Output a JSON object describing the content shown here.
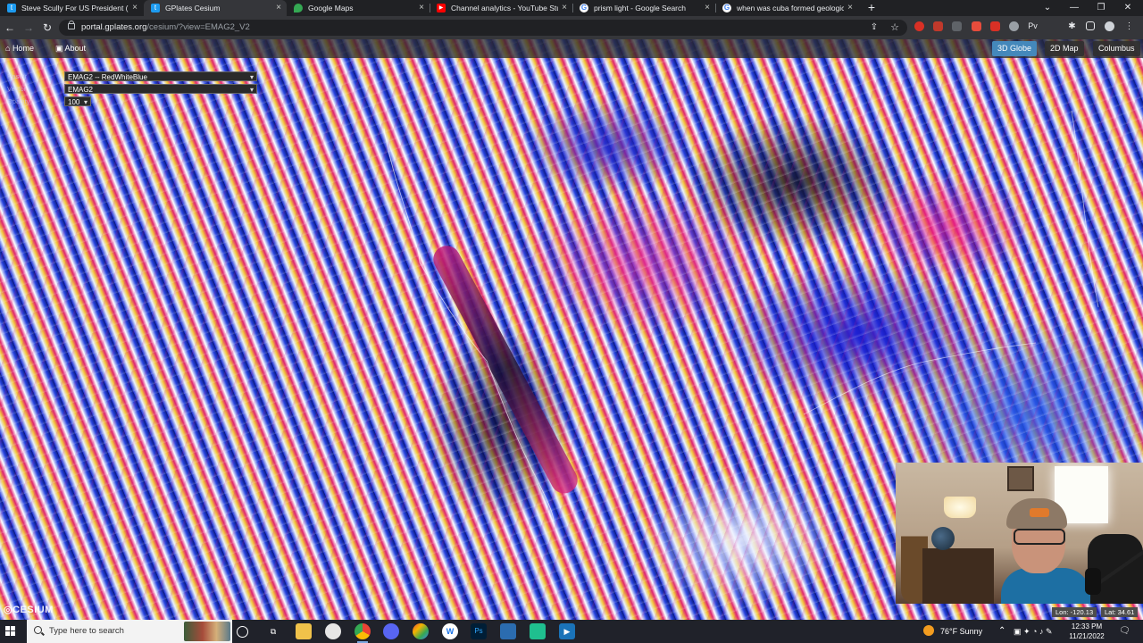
{
  "browser": {
    "tabs": [
      {
        "title": "Steve Scully For US President (@",
        "icon": "twitter-icon",
        "icon_color": "#1d9bf0",
        "active": false
      },
      {
        "title": "GPlates Cesium",
        "icon": "twitter-icon",
        "icon_color": "#1d9bf0",
        "active": true
      },
      {
        "title": "Google Maps",
        "icon": "map-pin-icon",
        "icon_color": "#34a853",
        "active": false
      },
      {
        "title": "Channel analytics - YouTube Stu",
        "icon": "youtube-icon",
        "icon_color": "#ff0000",
        "active": false
      },
      {
        "title": "prism light - Google Search",
        "icon": "google-icon",
        "icon_color": "#4285f4",
        "active": false
      },
      {
        "title": "when was cuba formed geologic",
        "icon": "google-icon",
        "icon_color": "#4285f4",
        "active": false
      }
    ],
    "url_host": "portal.gplates.org",
    "url_path": "/cesium/?view=EMAG2_V2"
  },
  "app": {
    "nav": {
      "home": "Home",
      "about": "About"
    },
    "modes": [
      "3D Globe",
      "2D Map",
      "Columbus"
    ],
    "layer_label": "Raster",
    "layer_select": "EMAG2 -- RedWhiteBlue",
    "dataset_label": "Vector",
    "dataset_select": "EMAG2",
    "opacity_label": "Opacity",
    "opacity_select": "100",
    "logo": "CESIUM",
    "lon": "Lon: -120.13",
    "lat": "Lat: 34.61"
  },
  "taskbar": {
    "search_placeholder": "Type here to search",
    "weather": "76°F  Sunny",
    "time": "12:33 PM",
    "date": "11/21/2022"
  },
  "colors": {
    "accent": "#4488bb",
    "magnetic_positive": "#e0246f",
    "magnetic_negative": "#1a2fd6"
  }
}
